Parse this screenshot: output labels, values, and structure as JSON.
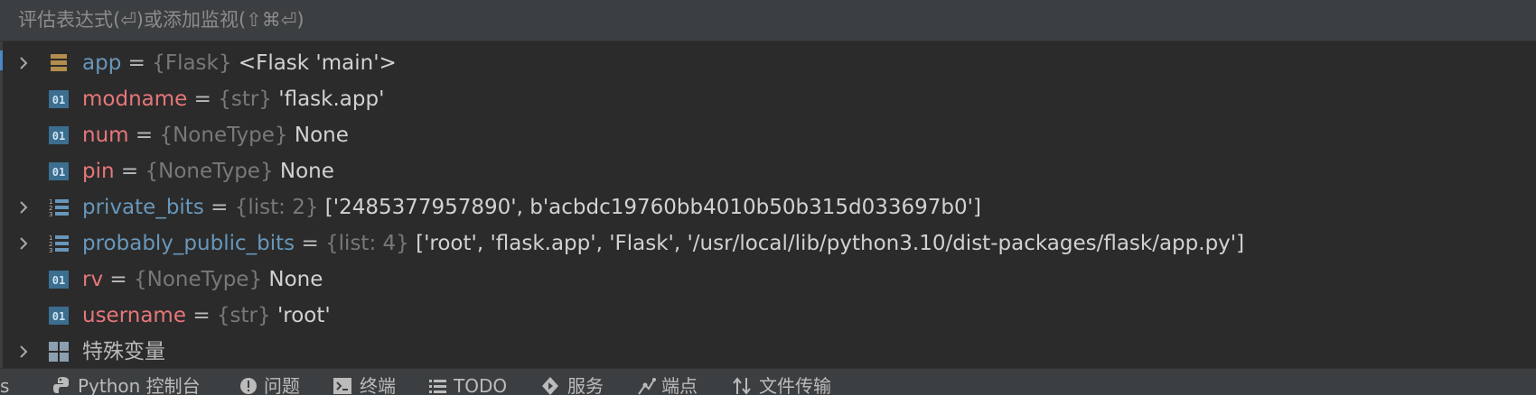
{
  "evaluate_bar": {
    "placeholder": "评估表达式(⏎)或添加监视(⇧⌘⏎)"
  },
  "variables": [
    {
      "name": "app",
      "type": "{Flask}",
      "value": "<Flask 'main'>",
      "expandable": true,
      "icon": "object-icon",
      "name_color": "#6897bb"
    },
    {
      "name": "modname",
      "type": "{str}",
      "value": "'flask.app'",
      "expandable": false,
      "icon": "primitive-icon",
      "name_color": "#e8767a"
    },
    {
      "name": "num",
      "type": "{NoneType}",
      "value": "None",
      "expandable": false,
      "icon": "primitive-icon",
      "name_color": "#e8767a"
    },
    {
      "name": "pin",
      "type": "{NoneType}",
      "value": "None",
      "expandable": false,
      "icon": "primitive-icon",
      "name_color": "#e8767a"
    },
    {
      "name": "private_bits",
      "type": "{list: 2}",
      "value": "['2485377957890', b'acbdc19760bb4010b50b315d033697b0']",
      "expandable": true,
      "icon": "list-icon",
      "name_color": "#6897bb"
    },
    {
      "name": "probably_public_bits",
      "type": "{list: 4}",
      "value": "['root', 'flask.app', 'Flask', '/usr/local/lib/python3.10/dist-packages/flask/app.py']",
      "expandable": true,
      "icon": "list-icon",
      "name_color": "#6897bb"
    },
    {
      "name": "rv",
      "type": "{NoneType}",
      "value": "None",
      "expandable": false,
      "icon": "primitive-icon",
      "name_color": "#e8767a"
    },
    {
      "name": "username",
      "type": "{str}",
      "value": "'root'",
      "expandable": false,
      "icon": "primitive-icon",
      "name_color": "#e8767a"
    },
    {
      "name": "特殊变量",
      "type": "",
      "value": "",
      "expandable": true,
      "icon": "grid-icon",
      "name_color": "#bababa"
    }
  ],
  "equals_sign": "=",
  "bottom_toolbar": {
    "partial_left": "s",
    "items": [
      {
        "label": "Python 控制台",
        "icon": "python-icon"
      },
      {
        "label": "问题",
        "icon": "problems-icon"
      },
      {
        "label": "终端",
        "icon": "terminal-icon"
      },
      {
        "label": "TODO",
        "icon": "todo-icon"
      },
      {
        "label": "服务",
        "icon": "services-icon"
      },
      {
        "label": "端点",
        "icon": "endpoints-icon"
      },
      {
        "label": "文件传输",
        "icon": "file-transfer-icon"
      }
    ]
  }
}
